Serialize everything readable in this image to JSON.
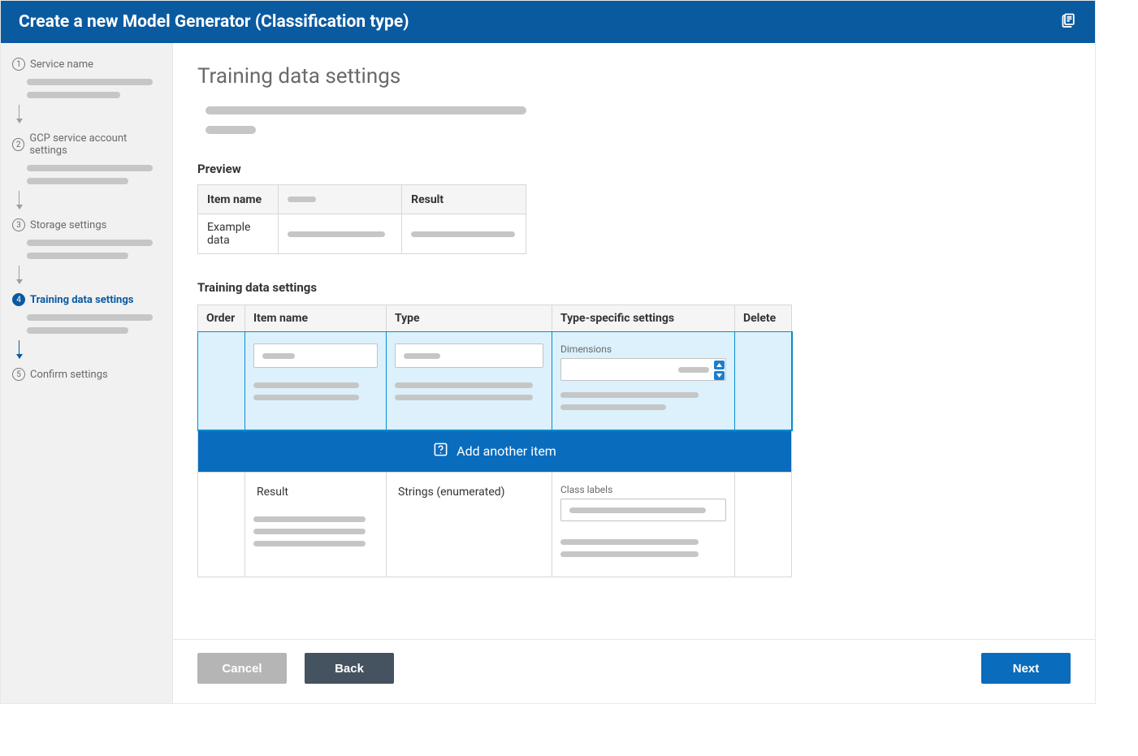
{
  "topbar": {
    "title": "Create a new Model Generator (Classification type)"
  },
  "sidebar": {
    "steps": [
      {
        "num": "1",
        "label": "Service name"
      },
      {
        "num": "2",
        "label": "GCP service account settings"
      },
      {
        "num": "3",
        "label": "Storage settings"
      },
      {
        "num": "4",
        "label": "Training data settings"
      },
      {
        "num": "5",
        "label": "Confirm settings"
      }
    ]
  },
  "page": {
    "title": "Training data settings"
  },
  "preview": {
    "heading": "Preview",
    "headers": {
      "item": "Item name",
      "result": "Result"
    },
    "row_label": "Example data"
  },
  "training": {
    "heading": "Training data settings",
    "headers": {
      "order": "Order",
      "item": "Item name",
      "type": "Type",
      "typespec": "Type-specific settings",
      "delete": "Delete"
    },
    "rows": [
      {
        "dimensions_label": "Dimensions"
      },
      {
        "item": "Result",
        "type": "Strings (enumerated)",
        "class_labels_label": "Class labels"
      }
    ],
    "add_label": "Add another item"
  },
  "footer": {
    "cancel": "Cancel",
    "back": "Back",
    "next": "Next"
  }
}
